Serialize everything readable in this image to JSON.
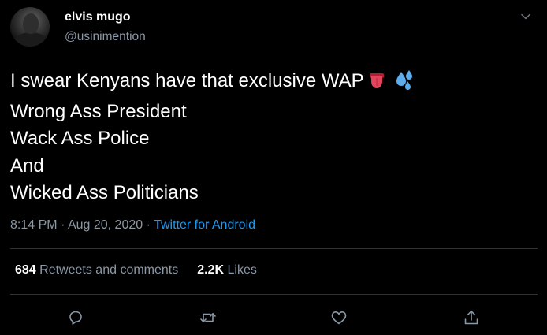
{
  "user": {
    "display_name": "elvis mugo",
    "handle": "@usinimention"
  },
  "tweet": {
    "lines": [
      "I swear Kenyans have that exclusive WAP",
      "Wrong Ass President",
      "Wack Ass Police",
      "And",
      "Wicked Ass Politicians"
    ],
    "emojis": [
      "tongue-emoji",
      "sweat-droplets-emoji"
    ]
  },
  "meta": {
    "time": "8:14 PM",
    "separator": "·",
    "date": "Aug 20, 2020",
    "source": "Twitter for Android"
  },
  "stats": {
    "retweets_count": "684",
    "retweets_label": "Retweets and comments",
    "likes_count": "2.2K",
    "likes_label": "Likes"
  },
  "actions": [
    "reply-icon",
    "retweet-icon",
    "like-icon",
    "share-icon"
  ],
  "colors": {
    "background": "#000000",
    "text": "#ffffff",
    "secondary": "#8b98a5",
    "accent": "#1d9bf0",
    "divider": "#2f3336"
  }
}
